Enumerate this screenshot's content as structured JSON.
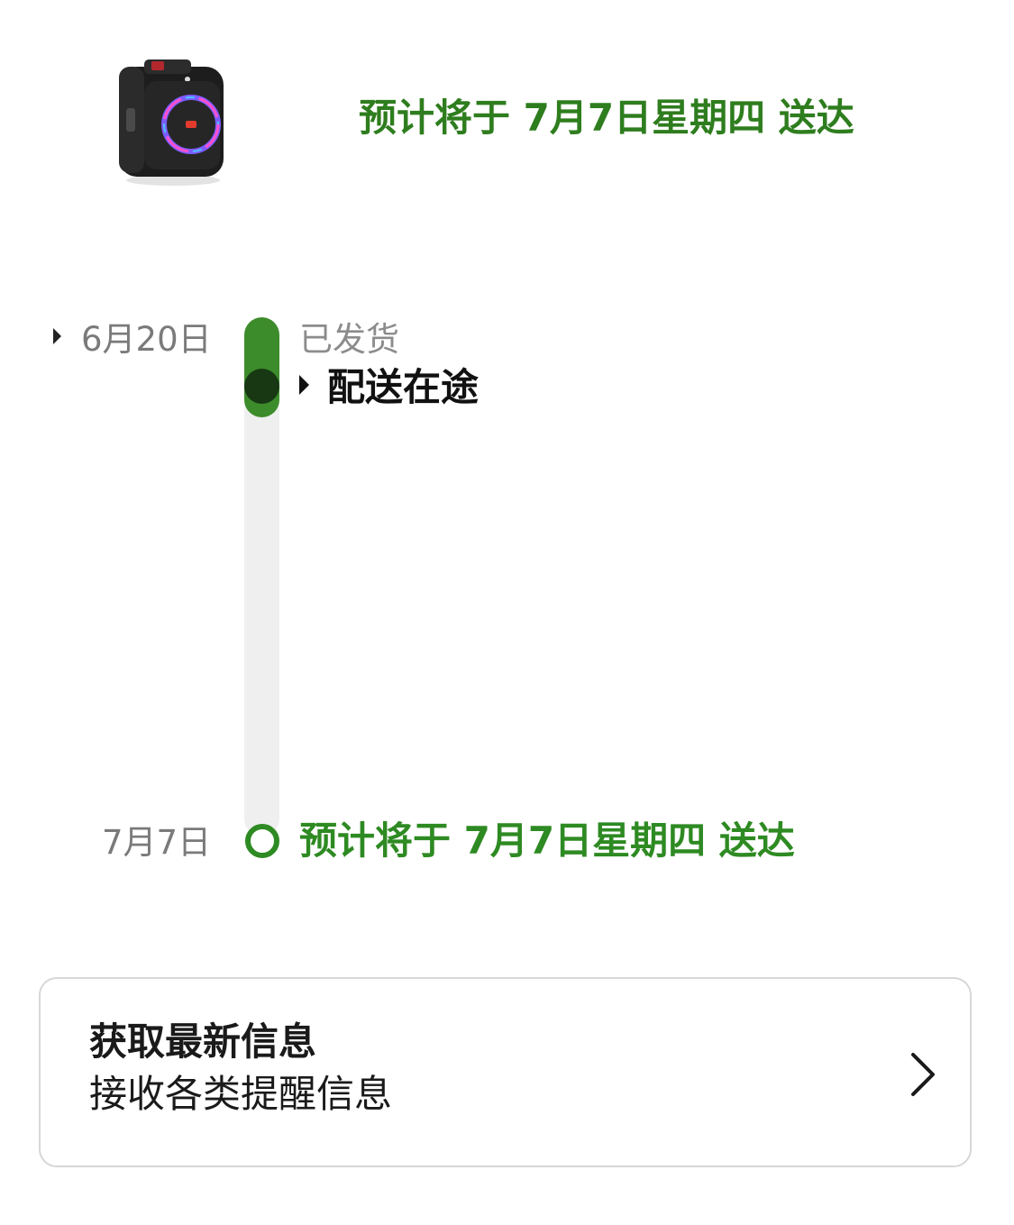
{
  "header": {
    "product_image_icon": "speaker-product-image",
    "delivery_estimate": "预计将于 7月7日星期四 送达"
  },
  "timeline": {
    "start_date": "6月20日",
    "end_date": "7月7日",
    "shipped_label": "已发货",
    "current_status": "配送在途",
    "final_status": "预计将于 7月7日星期四 送达",
    "progress_fraction": 0.19
  },
  "updates_card": {
    "title": "获取最新信息",
    "subtitle": "接收各类提醒信息",
    "chevron_icon": "chevron-right-icon"
  },
  "colors": {
    "accent_green": "#2e8a22",
    "progress_green": "#3d8c2b",
    "current_dot": "#173813",
    "track_gray": "#efefef"
  }
}
